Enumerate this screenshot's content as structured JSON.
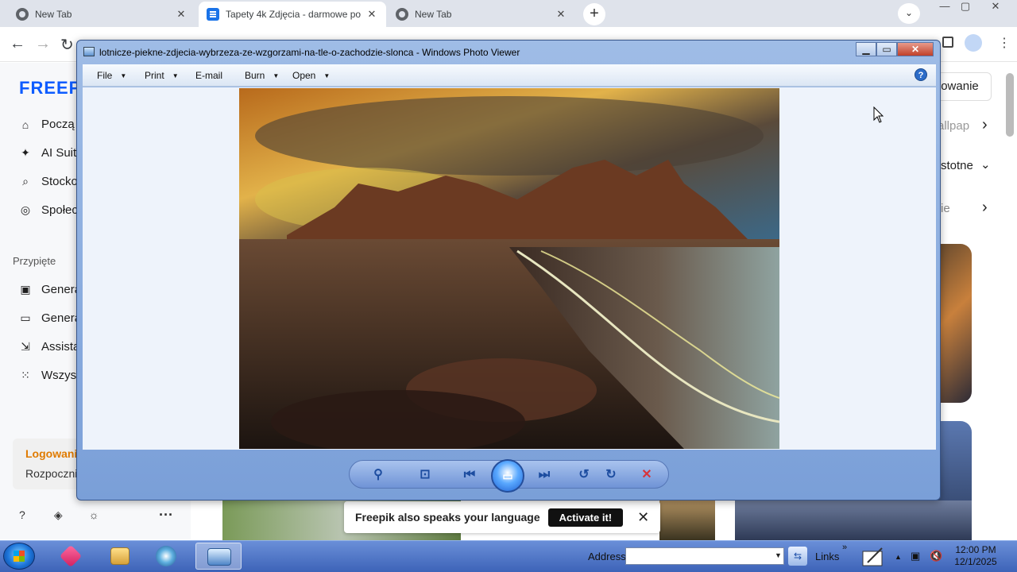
{
  "browser": {
    "tabs": [
      {
        "label": "New Tab",
        "close": "✕"
      },
      {
        "label": "Tapety 4k Zdjęcia - darmowe po",
        "close": "✕"
      },
      {
        "label": "New Tab",
        "close": "✕"
      }
    ],
    "new_tab": "+",
    "tab_search": "⌄",
    "window_controls": {
      "minimize": "—",
      "maximize": "▢",
      "close": "✕"
    },
    "nav": {
      "back": "←",
      "forward": "→",
      "reload": "↻"
    },
    "menu": "⋮"
  },
  "site": {
    "logo": "FREEP",
    "nav": [
      {
        "icon": "⌂",
        "label": "Począ"
      },
      {
        "icon": "✦",
        "label": "AI Suit"
      },
      {
        "icon": "⌕",
        "label": "Stocko"
      },
      {
        "icon": "◎",
        "label": "Społec"
      }
    ],
    "pinned_heading": "Przypięte",
    "pinned": [
      {
        "icon": "▣",
        "label": "Genera"
      },
      {
        "icon": "▭",
        "label": "Genera"
      },
      {
        "icon": "⇲",
        "label": "Assista"
      },
      {
        "icon": "⁙",
        "label": "Wszys"
      }
    ],
    "login_title": "Logowani",
    "login_sub": "Rozpoczni",
    "footer_icons": [
      "?",
      "◈",
      "☼"
    ],
    "more": "···",
    "login_button": "owanie",
    "right_items": [
      {
        "label": "allpap",
        "arrow": "›"
      },
      {
        "label": "stotne",
        "arrow": "⌄"
      },
      {
        "label": "ie",
        "arrow": "›"
      }
    ],
    "language_banner": {
      "text": "Freepik also speaks your language",
      "button": "Activate it!",
      "close": "✕"
    }
  },
  "photo_viewer": {
    "title": "lotnicze-piekne-zdjecia-wybrzeza-ze-wzgorzami-na-tle-o-zachodzie-slonca - Windows Photo Viewer",
    "caption_buttons": {
      "minimize": "▁",
      "maximize": "▭",
      "close": "✕"
    },
    "menu": [
      {
        "label": "File",
        "arrow": "▼"
      },
      {
        "label": "Print",
        "arrow": "▼"
      },
      {
        "label": "E-mail",
        "arrow": ""
      },
      {
        "label": "Burn",
        "arrow": "▼"
      },
      {
        "label": "Open",
        "arrow": "▼"
      }
    ],
    "help": "?",
    "controls": {
      "zoom": "⚲",
      "actual_size": "⊡",
      "previous": "⏮",
      "slideshow": "▭",
      "next": "⏭",
      "rotate_ccw": "↺",
      "rotate_cw": "↻",
      "delete": "✕"
    }
  },
  "taskbar": {
    "address_label": "Address",
    "address_value": "",
    "address_dropdown": "▼",
    "go": "⇆",
    "links_label": "Links",
    "links_chevron": "»",
    "tray": {
      "expand": "▲",
      "network": "▣",
      "volume": "🔇"
    },
    "time": "12:00 PM",
    "date": "12/1/2025"
  },
  "colors": {
    "brand": "#0d5cff",
    "login_accent": "#e07b00",
    "viewer_frame": "#7a9fd8",
    "taskbar": "#3d63b8"
  }
}
